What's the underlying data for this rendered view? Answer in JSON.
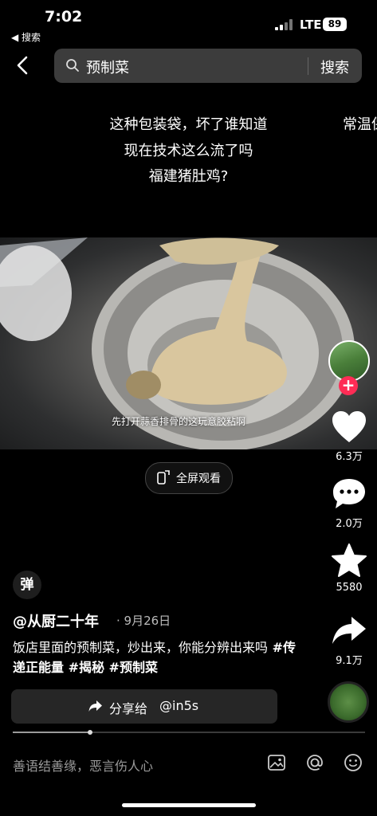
{
  "status": {
    "time": "7:02",
    "back_app": "◀ 搜索",
    "network": "LTE",
    "battery": "89"
  },
  "search": {
    "query": "预制菜",
    "button": "搜索"
  },
  "overlay": {
    "line1": "这种包装袋，坏了谁知道",
    "line2": "现在技术这么流了吗",
    "line3": "福建猪肚鸡?",
    "side": "常温保"
  },
  "video": {
    "caption": "先打开蒜香排骨的这玩意胶粘啊",
    "fullscreen": "全屏观看"
  },
  "rail": {
    "likes": "6.3万",
    "comments": "2.0万",
    "favorites": "5580",
    "shares": "9.1万"
  },
  "post": {
    "danmu": "弹",
    "author": "@从厨二十年",
    "date": "· 9月26日",
    "desc": "饭店里面的预制菜，炒出来，你能分辨出来吗",
    "tags": " #传递正能量 #揭秘 #预制菜",
    "share_label": "分享给",
    "share_user": "@in5s",
    "progress": 0.22
  },
  "comment": {
    "placeholder": "善语结善缘，恶言伤人心"
  },
  "icons": [
    "search-icon",
    "back-arrow-icon",
    "heart-icon",
    "comment-icon",
    "star-icon",
    "share-icon",
    "image-icon",
    "at-icon",
    "emoji-icon",
    "fullscreen-icon"
  ],
  "colors": {
    "accent": "#fe2c55",
    "bg": "#000000"
  }
}
